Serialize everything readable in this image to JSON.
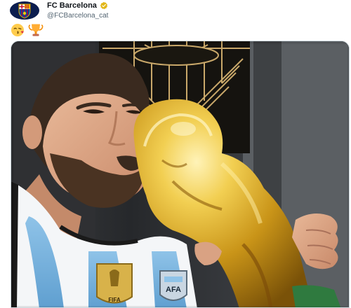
{
  "account": {
    "display_name": "FC Barcelona",
    "handle": "@FCBarcelona_cat",
    "verified": true,
    "avatar_icon": "fc-barcelona-crest-icon"
  },
  "tweet": {
    "emojis": [
      "face-blowing-kiss-emoji",
      "trophy-emoji"
    ]
  },
  "media": {
    "kit_badge_text": "AFA",
    "champions_badge_text": "FIFA"
  },
  "colors": {
    "accent": "#1d9bf0",
    "verified_gold": "#e2b719",
    "name_text": "#0f1419",
    "handle_text": "#536471",
    "barca_blue": "#004d98",
    "barca_red": "#a50044"
  }
}
